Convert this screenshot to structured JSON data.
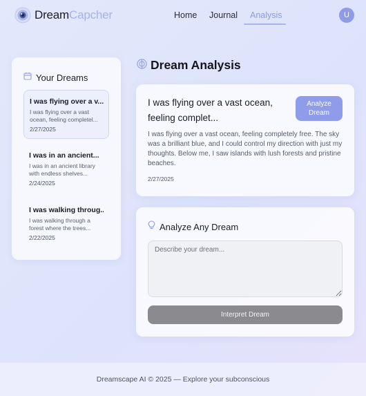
{
  "brand": {
    "name_part1": "Dream",
    "name_part2": "Capcher"
  },
  "nav": {
    "items": [
      {
        "label": "Home",
        "active": false
      },
      {
        "label": "Journal",
        "active": false
      },
      {
        "label": "Analysis",
        "active": true
      }
    ]
  },
  "user": {
    "avatar_initial": "U"
  },
  "sidebar": {
    "title": "Your Dreams",
    "icon": "calendar-icon",
    "dreams": [
      {
        "title": "I was flying over a v...",
        "snippet": "I was flying over a vast ocean, feeling completel...",
        "date": "2/27/2025",
        "selected": true
      },
      {
        "title": "I was in an ancient...",
        "snippet": "I was in an ancient library with endless shelves...",
        "date": "2/24/2025",
        "selected": false
      },
      {
        "title": "I was walking throug...",
        "snippet": "I was walking through a forest where the trees...",
        "date": "2/22/2025",
        "selected": false
      }
    ]
  },
  "main": {
    "title": "Dream Analysis",
    "icon": "brain-icon",
    "selected_dream": {
      "title": "I was flying over a vast ocean, feeling complet...",
      "body": "I was flying over a vast ocean, feeling completely free. The sky was a brilliant blue, and I could control my direction with just my thoughts. Below me, I saw islands with lush forests and pristine beaches.",
      "date": "2/27/2025",
      "analyze_label": "Analyze Dream"
    },
    "analyze_any": {
      "title": "Analyze Any Dream",
      "icon": "lightbulb-icon",
      "placeholder": "Describe your dream...",
      "button_label": "Interpret Dream"
    }
  },
  "footer": {
    "text": "Dreamscape AI © 2025 — Explore your subconscious"
  },
  "colors": {
    "accent": "#8f9ce9",
    "brand_light": "#a7b2ea",
    "button_gray": "#8a8a8f"
  }
}
